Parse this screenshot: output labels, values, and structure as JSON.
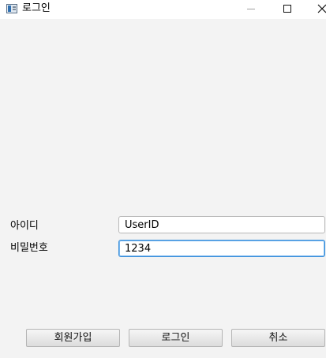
{
  "window": {
    "title": "로그인"
  },
  "form": {
    "id_label": "아이디",
    "id_value": "UserID",
    "password_label": "비밀번호",
    "password_value": "1234"
  },
  "buttons": {
    "signup": "회원가입",
    "login": "로그인",
    "cancel": "취소"
  }
}
